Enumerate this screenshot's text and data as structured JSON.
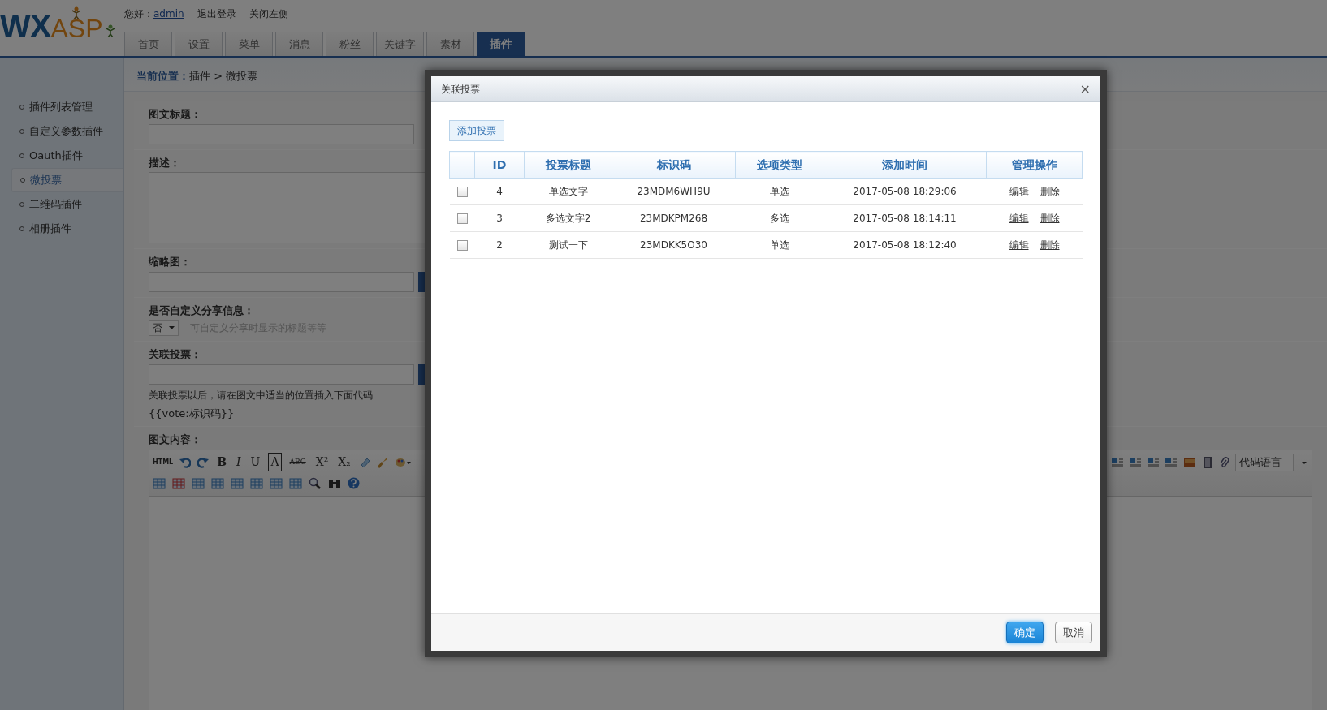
{
  "header": {
    "logo_left": "WX",
    "logo_right": "ASP",
    "greeting": "您好：",
    "user": "admin",
    "links": [
      "退出登录",
      "关闭左侧"
    ]
  },
  "tabs": [
    {
      "label": "首页",
      "selected": false
    },
    {
      "label": "设置",
      "selected": false
    },
    {
      "label": "菜单",
      "selected": false
    },
    {
      "label": "消息",
      "selected": false
    },
    {
      "label": "粉丝",
      "selected": false
    },
    {
      "label": "关键字",
      "selected": false
    },
    {
      "label": "素材",
      "selected": false
    },
    {
      "label": "插件",
      "selected": true
    }
  ],
  "sidebar": {
    "items": [
      {
        "label": "插件列表管理",
        "selected": false
      },
      {
        "label": "自定义参数插件",
        "selected": false
      },
      {
        "label": "Oauth插件",
        "selected": false
      },
      {
        "label": "微投票",
        "selected": true
      },
      {
        "label": "二维码插件",
        "selected": false
      },
      {
        "label": "相册插件",
        "selected": false
      }
    ]
  },
  "breadcrumb": {
    "label": "当前位置：",
    "path": "插件 > 微投票"
  },
  "form": {
    "fields": [
      {
        "kind": "text",
        "label": "图文标题："
      },
      {
        "kind": "textarea",
        "label": "描述："
      },
      {
        "kind": "upload",
        "label": "缩略图："
      },
      {
        "kind": "select",
        "label": "是否自定义分享信息：",
        "value": "否",
        "hint": "可自定义分享时显示的标题等等"
      },
      {
        "kind": "upload",
        "label": "关联投票：",
        "help": "关联投票以后，请在图文中适当的位置插入下面代码",
        "code": "{{vote:标识码}}"
      }
    ]
  },
  "editor": {
    "label": "图文内容：",
    "html": "HTML",
    "format_buttons": [
      "B",
      "I",
      "U",
      "A",
      "ABC",
      "X²",
      "X₂"
    ],
    "code_language": "代码语言"
  },
  "dialog": {
    "title": "关联投票",
    "close": "×",
    "add_button": "添加投票",
    "columns": [
      "ID",
      "投票标题",
      "标识码",
      "选项类型",
      "添加时间",
      "管理操作"
    ],
    "rows": [
      {
        "checked": false,
        "id": "4",
        "title": "单选文字",
        "code": "23MDM6WH9U",
        "type": "单选",
        "time": "2017-05-08 18:29:06",
        "actions": [
          "编辑",
          "删除"
        ]
      },
      {
        "checked": false,
        "id": "3",
        "title": "多选文字2",
        "code": "23MDKPM268",
        "type": "多选",
        "time": "2017-05-08 18:14:11",
        "actions": [
          "编辑",
          "删除"
        ]
      },
      {
        "checked": false,
        "id": "2",
        "title": "测试一下",
        "code": "23MDKK5O30",
        "type": "单选",
        "time": "2017-05-08 18:12:40",
        "actions": [
          "编辑",
          "删除"
        ]
      }
    ],
    "ok": "确定",
    "cancel": "取消"
  }
}
